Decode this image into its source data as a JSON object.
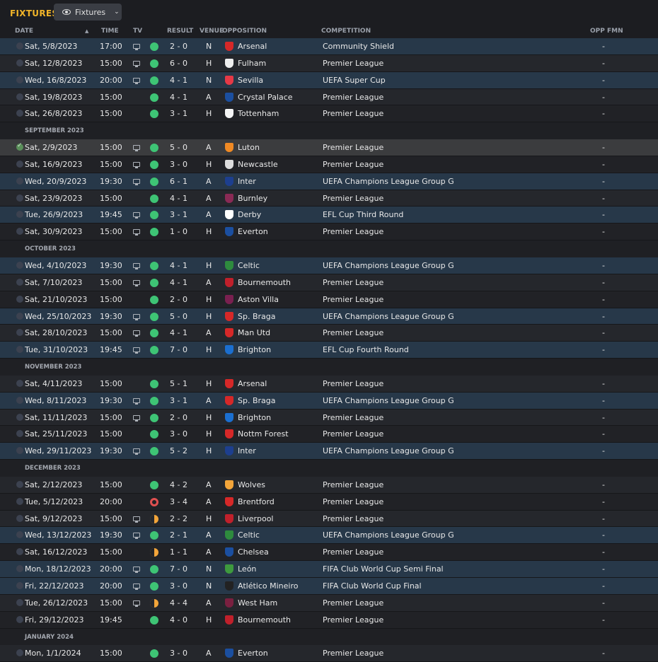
{
  "page": {
    "title": "FIXTURES",
    "view_label": "Fixtures"
  },
  "columns": {
    "date": "DATE",
    "time": "TIME",
    "tv": "TV",
    "result": "RESULT",
    "venue": "VENUE",
    "opposition": "OPPOSITION",
    "competition": "COMPETITION",
    "opp_fmn": "OPP FMN"
  },
  "fixtures": [
    {
      "date": "Sat, 5/8/2023",
      "time": "17:00",
      "tv": true,
      "outcome": "W",
      "result": "2 - 0",
      "venue": "N",
      "opposition": "Arsenal",
      "crest": "#d62828",
      "competition": "Community Shield",
      "opp_fmn": "-",
      "band": "euro"
    },
    {
      "date": "Sat, 12/8/2023",
      "time": "15:00",
      "tv": true,
      "outcome": "W",
      "result": "6 - 0",
      "venue": "H",
      "opposition": "Fulham",
      "crest": "#eeeeee",
      "competition": "Premier League",
      "opp_fmn": "-",
      "band": "odd"
    },
    {
      "date": "Wed, 16/8/2023",
      "time": "20:00",
      "tv": true,
      "outcome": "W",
      "result": "4 - 1",
      "venue": "N",
      "opposition": "Sevilla",
      "crest": "#e63946",
      "competition": "UEFA Super Cup",
      "opp_fmn": "-",
      "band": "euro"
    },
    {
      "date": "Sat, 19/8/2023",
      "time": "15:00",
      "tv": false,
      "outcome": "W",
      "result": "4 - 1",
      "venue": "A",
      "opposition": "Crystal Palace",
      "crest": "#1b4fa0",
      "competition": "Premier League",
      "opp_fmn": "-",
      "band": "odd"
    },
    {
      "date": "Sat, 26/8/2023",
      "time": "15:00",
      "tv": false,
      "outcome": "W",
      "result": "3 - 1",
      "venue": "H",
      "opposition": "Tottenham",
      "crest": "#f5f5f5",
      "competition": "Premier League",
      "opp_fmn": "-",
      "band": "even"
    },
    {
      "month": "SEPTEMBER 2023"
    },
    {
      "date": "Sat, 2/9/2023",
      "time": "15:00",
      "tv": true,
      "outcome": "W",
      "result": "5 - 0",
      "venue": "A",
      "opposition": "Luton",
      "crest": "#f08a24",
      "competition": "Premier League",
      "opp_fmn": "-",
      "band": "sel",
      "done": true
    },
    {
      "date": "Sat, 16/9/2023",
      "time": "15:00",
      "tv": true,
      "outcome": "W",
      "result": "3 - 0",
      "venue": "H",
      "opposition": "Newcastle",
      "crest": "#dddddd",
      "competition": "Premier League",
      "opp_fmn": "-",
      "band": "even"
    },
    {
      "date": "Wed, 20/9/2023",
      "time": "19:30",
      "tv": true,
      "outcome": "W",
      "result": "6 - 1",
      "venue": "A",
      "opposition": "Inter",
      "crest": "#1d3f8f",
      "competition": "UEFA Champions League Group G",
      "opp_fmn": "-",
      "band": "euro"
    },
    {
      "date": "Sat, 23/9/2023",
      "time": "15:00",
      "tv": false,
      "outcome": "W",
      "result": "4 - 1",
      "venue": "A",
      "opposition": "Burnley",
      "crest": "#8a2a55",
      "competition": "Premier League",
      "opp_fmn": "-",
      "band": "odd"
    },
    {
      "date": "Tue, 26/9/2023",
      "time": "19:45",
      "tv": true,
      "outcome": "W",
      "result": "3 - 1",
      "venue": "A",
      "opposition": "Derby",
      "crest": "#ffffff",
      "competition": "EFL Cup Third Round",
      "opp_fmn": "-",
      "band": "euro"
    },
    {
      "date": "Sat, 30/9/2023",
      "time": "15:00",
      "tv": true,
      "outcome": "W",
      "result": "1 - 0",
      "venue": "H",
      "opposition": "Everton",
      "crest": "#1b4fa0",
      "competition": "Premier League",
      "opp_fmn": "-",
      "band": "even"
    },
    {
      "month": "OCTOBER 2023"
    },
    {
      "date": "Wed, 4/10/2023",
      "time": "19:30",
      "tv": true,
      "outcome": "W",
      "result": "4 - 1",
      "venue": "H",
      "opposition": "Celtic",
      "crest": "#2e8b3e",
      "competition": "UEFA Champions League Group G",
      "opp_fmn": "-",
      "band": "euro"
    },
    {
      "date": "Sat, 7/10/2023",
      "time": "15:00",
      "tv": true,
      "outcome": "W",
      "result": "4 - 1",
      "venue": "A",
      "opposition": "Bournemouth",
      "crest": "#c0202b",
      "competition": "Premier League",
      "opp_fmn": "-",
      "band": "odd"
    },
    {
      "date": "Sat, 21/10/2023",
      "time": "15:00",
      "tv": false,
      "outcome": "W",
      "result": "2 - 0",
      "venue": "H",
      "opposition": "Aston Villa",
      "crest": "#7a2050",
      "competition": "Premier League",
      "opp_fmn": "-",
      "band": "even"
    },
    {
      "date": "Wed, 25/10/2023",
      "time": "19:30",
      "tv": true,
      "outcome": "W",
      "result": "5 - 0",
      "venue": "H",
      "opposition": "Sp. Braga",
      "crest": "#d62828",
      "competition": "UEFA Champions League Group G",
      "opp_fmn": "-",
      "band": "euro"
    },
    {
      "date": "Sat, 28/10/2023",
      "time": "15:00",
      "tv": true,
      "outcome": "W",
      "result": "4 - 1",
      "venue": "A",
      "opposition": "Man Utd",
      "crest": "#d62828",
      "competition": "Premier League",
      "opp_fmn": "-",
      "band": "odd"
    },
    {
      "date": "Tue, 31/10/2023",
      "time": "19:45",
      "tv": true,
      "outcome": "W",
      "result": "7 - 0",
      "venue": "H",
      "opposition": "Brighton",
      "crest": "#1b6fd0",
      "competition": "EFL Cup Fourth Round",
      "opp_fmn": "-",
      "band": "euro"
    },
    {
      "month": "NOVEMBER 2023"
    },
    {
      "date": "Sat, 4/11/2023",
      "time": "15:00",
      "tv": false,
      "outcome": "W",
      "result": "5 - 1",
      "venue": "H",
      "opposition": "Arsenal",
      "crest": "#d62828",
      "competition": "Premier League",
      "opp_fmn": "-",
      "band": "odd"
    },
    {
      "date": "Wed, 8/11/2023",
      "time": "19:30",
      "tv": true,
      "outcome": "W",
      "result": "3 - 1",
      "venue": "A",
      "opposition": "Sp. Braga",
      "crest": "#d62828",
      "competition": "UEFA Champions League Group G",
      "opp_fmn": "-",
      "band": "euro"
    },
    {
      "date": "Sat, 11/11/2023",
      "time": "15:00",
      "tv": true,
      "outcome": "W",
      "result": "2 - 0",
      "venue": "H",
      "opposition": "Brighton",
      "crest": "#1b6fd0",
      "competition": "Premier League",
      "opp_fmn": "-",
      "band": "odd"
    },
    {
      "date": "Sat, 25/11/2023",
      "time": "15:00",
      "tv": false,
      "outcome": "W",
      "result": "3 - 0",
      "venue": "H",
      "opposition": "Nottm Forest",
      "crest": "#d62828",
      "competition": "Premier League",
      "opp_fmn": "-",
      "band": "even"
    },
    {
      "date": "Wed, 29/11/2023",
      "time": "19:30",
      "tv": true,
      "outcome": "W",
      "result": "5 - 2",
      "venue": "H",
      "opposition": "Inter",
      "crest": "#1d3f8f",
      "competition": "UEFA Champions League Group G",
      "opp_fmn": "-",
      "band": "euro"
    },
    {
      "month": "DECEMBER 2023"
    },
    {
      "date": "Sat, 2/12/2023",
      "time": "15:00",
      "tv": false,
      "outcome": "W",
      "result": "4 - 2",
      "venue": "A",
      "opposition": "Wolves",
      "crest": "#f3a53a",
      "competition": "Premier League",
      "opp_fmn": "-",
      "band": "odd"
    },
    {
      "date": "Tue, 5/12/2023",
      "time": "20:00",
      "tv": false,
      "outcome": "L",
      "result": "3 - 4",
      "venue": "A",
      "opposition": "Brentford",
      "crest": "#d62828",
      "competition": "Premier League",
      "opp_fmn": "-",
      "band": "even"
    },
    {
      "date": "Sat, 9/12/2023",
      "time": "15:00",
      "tv": true,
      "outcome": "D",
      "result": "2 - 2",
      "venue": "H",
      "opposition": "Liverpool",
      "crest": "#c0202b",
      "competition": "Premier League",
      "opp_fmn": "-",
      "band": "odd"
    },
    {
      "date": "Wed, 13/12/2023",
      "time": "19:30",
      "tv": true,
      "outcome": "W",
      "result": "2 - 1",
      "venue": "A",
      "opposition": "Celtic",
      "crest": "#2e8b3e",
      "competition": "UEFA Champions League Group G",
      "opp_fmn": "-",
      "band": "euro"
    },
    {
      "date": "Sat, 16/12/2023",
      "time": "15:00",
      "tv": false,
      "outcome": "D",
      "result": "1 - 1",
      "venue": "A",
      "opposition": "Chelsea",
      "crest": "#1b4fa0",
      "competition": "Premier League",
      "opp_fmn": "-",
      "band": "even"
    },
    {
      "date": "Mon, 18/12/2023",
      "time": "20:00",
      "tv": true,
      "outcome": "W",
      "result": "7 - 0",
      "venue": "N",
      "opposition": "León",
      "crest": "#3e9a3e",
      "competition": "FIFA Club World Cup Semi Final",
      "opp_fmn": "-",
      "band": "euro"
    },
    {
      "date": "Fri, 22/12/2023",
      "time": "20:00",
      "tv": true,
      "outcome": "W",
      "result": "3 - 0",
      "venue": "N",
      "opposition": "Atlético Mineiro",
      "crest": "#222222",
      "competition": "FIFA Club World Cup Final",
      "opp_fmn": "-",
      "band": "euro"
    },
    {
      "date": "Tue, 26/12/2023",
      "time": "15:00",
      "tv": true,
      "outcome": "D",
      "result": "4 - 4",
      "venue": "A",
      "opposition": "West Ham",
      "crest": "#7a2040",
      "competition": "Premier League",
      "opp_fmn": "-",
      "band": "odd"
    },
    {
      "date": "Fri, 29/12/2023",
      "time": "19:45",
      "tv": false,
      "outcome": "W",
      "result": "4 - 0",
      "venue": "H",
      "opposition": "Bournemouth",
      "crest": "#c0202b",
      "competition": "Premier League",
      "opp_fmn": "-",
      "band": "even"
    },
    {
      "month": "JANUARY 2024"
    },
    {
      "date": "Mon, 1/1/2024",
      "time": "15:00",
      "tv": false,
      "outcome": "W",
      "result": "3 - 0",
      "venue": "A",
      "opposition": "Everton",
      "crest": "#1b4fa0",
      "competition": "Premier League",
      "opp_fmn": "-",
      "band": "odd"
    }
  ]
}
